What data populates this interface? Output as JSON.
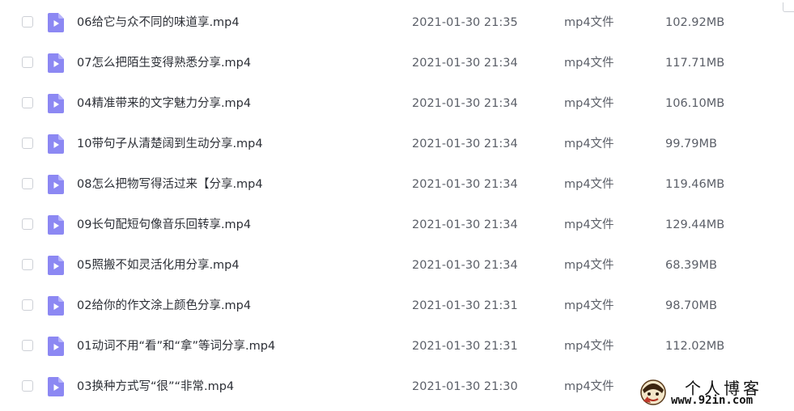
{
  "files": [
    {
      "name": "06给它与众不同的味道享.mp4",
      "date": "2021-01-30 21:35",
      "type": "mp4文件",
      "size": "102.92MB"
    },
    {
      "name": "07怎么把陌生变得熟悉分享.mp4",
      "date": "2021-01-30 21:34",
      "type": "mp4文件",
      "size": "117.71MB"
    },
    {
      "name": "04精准带来的文字魅力分享.mp4",
      "date": "2021-01-30 21:34",
      "type": "mp4文件",
      "size": "106.10MB"
    },
    {
      "name": "10带句子从清楚阔到生动分享.mp4",
      "date": "2021-01-30 21:34",
      "type": "mp4文件",
      "size": "99.79MB"
    },
    {
      "name": "08怎么把物写得活过来【分享.mp4",
      "date": "2021-01-30 21:34",
      "type": "mp4文件",
      "size": "119.46MB"
    },
    {
      "name": "09长句配短句像音乐回转享.mp4",
      "date": "2021-01-30 21:34",
      "type": "mp4文件",
      "size": "129.44MB"
    },
    {
      "name": "05照搬不如灵活化用分享.mp4",
      "date": "2021-01-30 21:34",
      "type": "mp4文件",
      "size": "68.39MB"
    },
    {
      "name": "02给你的作文涂上颜色分享.mp4",
      "date": "2021-01-30 21:31",
      "type": "mp4文件",
      "size": "98.70MB"
    },
    {
      "name": "01动词不用“看”和“拿”等词分享.mp4",
      "date": "2021-01-30 21:31",
      "type": "mp4文件",
      "size": "112.02MB"
    },
    {
      "name": "03换种方式写“很”“非常.mp4",
      "date": "2021-01-30 21:30",
      "type": "mp4文件",
      "size": ""
    }
  ],
  "watermark": {
    "title": "个人博客",
    "url": "www.92in.com"
  },
  "colors": {
    "video_icon": "#8c88f3",
    "video_icon_fold": "#b7b4fa",
    "checkbox_border": "#cdd0d6"
  },
  "icons": {
    "file": "video-file-icon",
    "play": "play-triangle"
  }
}
